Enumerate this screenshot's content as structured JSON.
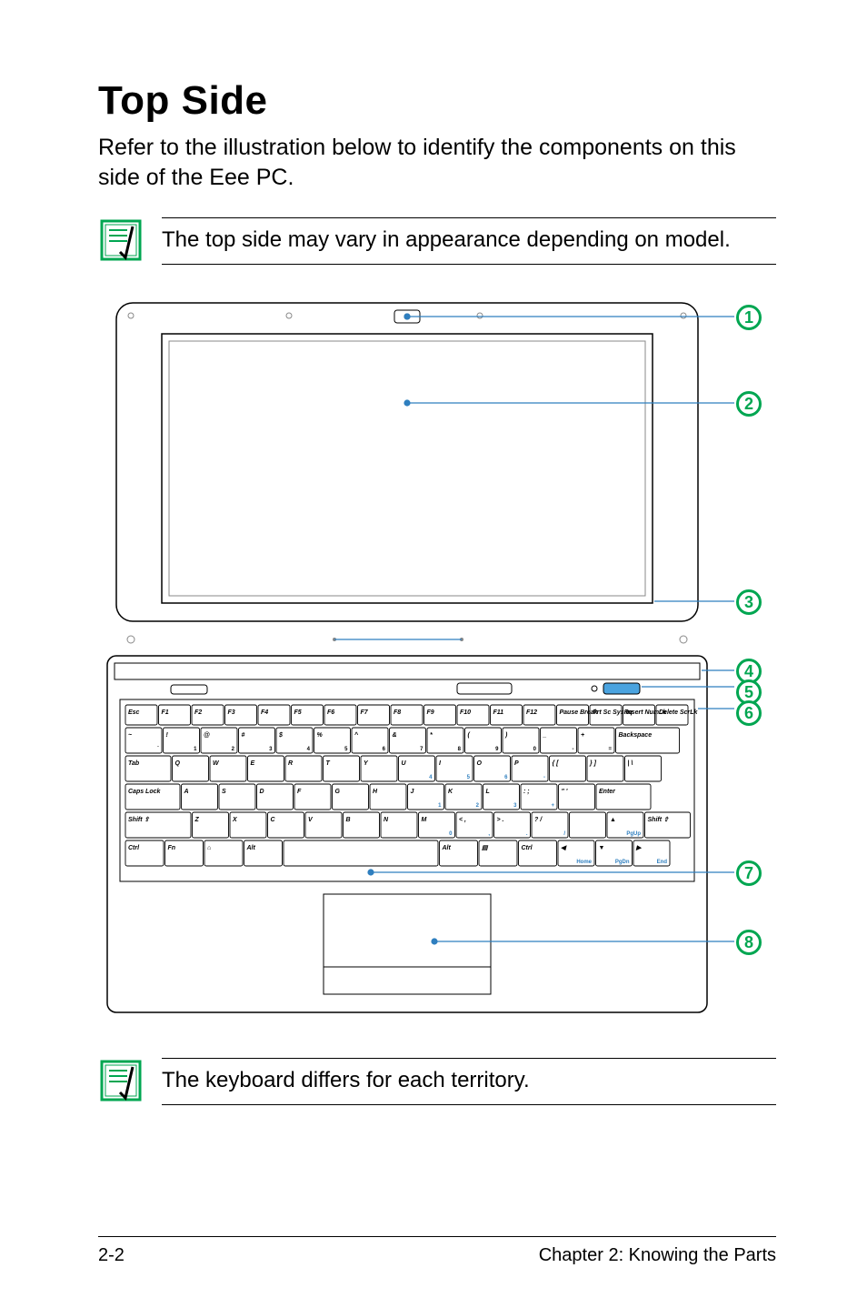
{
  "heading": "Top Side",
  "intro": "Refer to the illustration below to identify the components on this side of the Eee PC.",
  "note1": "The top side may vary in appearance depending on model.",
  "note2": "The keyboard differs for each territory.",
  "callouts": {
    "c1": "1",
    "c2": "2",
    "c3": "3",
    "c4": "4",
    "c5": "5",
    "c6": "6",
    "c7": "7",
    "c8": "8"
  },
  "keyboard": {
    "row_fn": [
      "Esc",
      "F1",
      "F2",
      "F3",
      "F4",
      "F5",
      "F6",
      "F7",
      "F8",
      "F9",
      "F10",
      "F11",
      "F12",
      "Pause Break",
      "Prt Sc SysRq",
      "Insert NumLk",
      "Delete ScrLk"
    ],
    "row_num_upper": [
      "~",
      "!",
      "@",
      "#",
      "$",
      "%",
      "^",
      "&",
      "*",
      "(",
      ")",
      "_",
      "+",
      "Backspace"
    ],
    "row_num_lower": [
      "`",
      "1",
      "2",
      "3",
      "4",
      "5",
      "6",
      "7",
      "8",
      "9",
      "0",
      "-",
      "="
    ],
    "row_q": [
      "Tab",
      "Q",
      "W",
      "E",
      "R",
      "T",
      "Y",
      "U",
      "I",
      "O",
      "P",
      "{ [",
      "} ]",
      "| \\"
    ],
    "row_a": [
      "Caps Lock",
      "A",
      "S",
      "D",
      "F",
      "G",
      "H",
      "J",
      "K",
      "L",
      ": ;",
      "\" '",
      "Enter"
    ],
    "row_z": [
      "Shift ⇧",
      "Z",
      "X",
      "C",
      "V",
      "B",
      "N",
      "M",
      "< ,",
      "> .",
      "? /",
      "",
      "PgUp",
      "Shift ⇧"
    ],
    "row_ctrl": [
      "Ctrl",
      "Fn",
      "⌂",
      "Alt",
      "",
      "Alt",
      "▤",
      "Ctrl",
      "◀ Home",
      "PgDn",
      "▶ End"
    ]
  },
  "footer": {
    "left": "2-2",
    "right": "Chapter 2: Knowing the Parts"
  }
}
